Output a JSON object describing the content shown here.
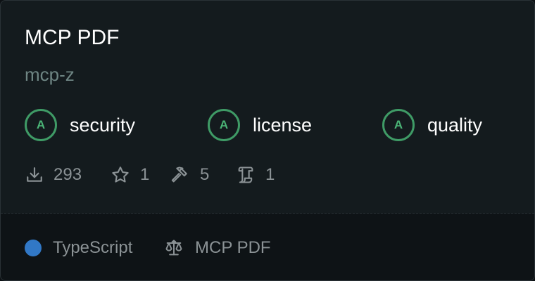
{
  "card": {
    "title": "MCP PDF",
    "author": "mcp-z"
  },
  "badges": [
    {
      "grade": "A",
      "label": "security"
    },
    {
      "grade": "A",
      "label": "license"
    },
    {
      "grade": "A",
      "label": "quality"
    }
  ],
  "stats": {
    "downloads": "293",
    "stars": "1",
    "tools": "5",
    "resources": "1"
  },
  "footer": {
    "language": "TypeScript",
    "language_color": "#3178c6",
    "license": "MCP PDF"
  },
  "colors": {
    "grade_ring": "#3f9b66",
    "grade_text": "#4bb577"
  }
}
